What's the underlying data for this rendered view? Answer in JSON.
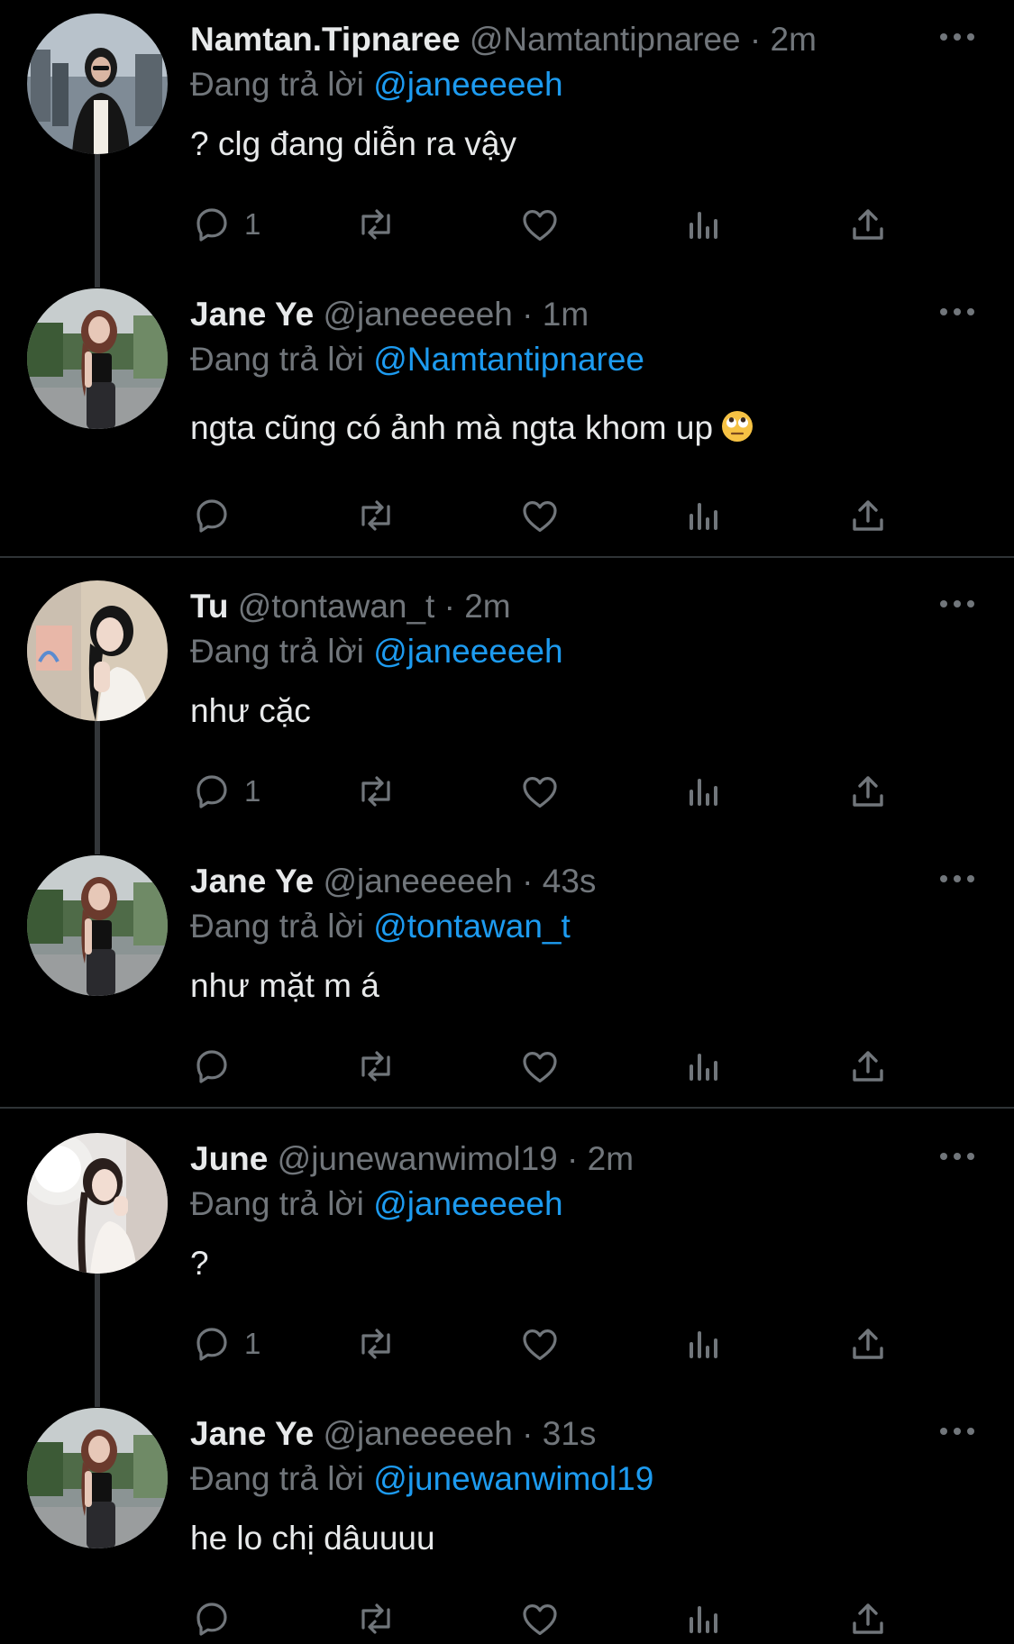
{
  "reply_prefix": "Đang trả lời",
  "separator": "·",
  "colors": {
    "background": "#000000",
    "text": "#e7e9ea",
    "secondary": "#71767b",
    "link": "#1d9bf0",
    "divider": "#2f3336"
  },
  "tweets": [
    {
      "name": "Namtan.Tipnaree",
      "handle": "@Namtantipnaree",
      "time": "2m",
      "reply_to": "@janeeeeeh",
      "text": "? clg đang diễn ra vậy",
      "reply_count": "1",
      "avatar": "avatar-namtan"
    },
    {
      "name": "Jane Ye",
      "handle": "@janeeeeeh",
      "time": "1m",
      "reply_to": "@Namtantipnaree",
      "text": "ngta cũng có ảnh mà ngta khom up",
      "emoji": "face-with-rolling-eyes-emoji",
      "reply_count": "",
      "avatar": "avatar-jane"
    },
    {
      "name": "Tu",
      "handle": "@tontawan_t",
      "time": "2m",
      "reply_to": "@janeeeeeh",
      "text": "như cặc",
      "reply_count": "1",
      "avatar": "avatar-tu"
    },
    {
      "name": "Jane Ye",
      "handle": "@janeeeeeh",
      "time": "43s",
      "reply_to": "@tontawan_t",
      "text": "như mặt m á",
      "reply_count": "",
      "avatar": "avatar-jane"
    },
    {
      "name": "June",
      "handle": "@junewanwimol19",
      "time": "2m",
      "reply_to": "@janeeeeeh",
      "text": "?",
      "reply_count": "1",
      "avatar": "avatar-june"
    },
    {
      "name": "Jane Ye",
      "handle": "@janeeeeeh",
      "time": "31s",
      "reply_to": "@junewanwimol19",
      "text": "he lo chị dâuuuu",
      "reply_count": "",
      "avatar": "avatar-jane"
    }
  ]
}
